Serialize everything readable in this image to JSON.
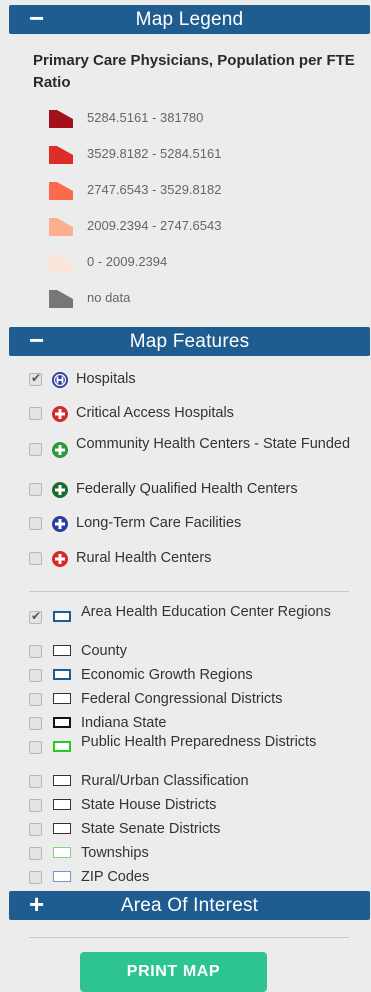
{
  "legend": {
    "header_title": "Map Legend",
    "header_sign": "−",
    "heading": "Primary Care Physicians, Population per FTE Ratio",
    "items": [
      {
        "label": "5284.5161 - 381780",
        "color": "#a3101c"
      },
      {
        "label": "3529.8182 - 5284.5161",
        "color": "#de2d26"
      },
      {
        "label": "2747.6543 - 3529.8182",
        "color": "#fb6a4a"
      },
      {
        "label": "2009.2394 - 2747.6543",
        "color": "#fcae91"
      },
      {
        "label": "0 - 2009.2394",
        "color": "#fee5d9"
      },
      {
        "label": "no data",
        "color": "#777777"
      }
    ]
  },
  "features": {
    "header_title": "Map Features",
    "header_sign": "−",
    "points": [
      {
        "label": "Hospitals",
        "checked": true,
        "icon": "hospital-h-icon",
        "color": "#2b3d9e"
      },
      {
        "label": "Critical Access Hospitals",
        "checked": false,
        "icon": "red-plus-icon",
        "color": "#d32a2a"
      },
      {
        "label": "Community Health Centers - State Funded",
        "checked": false,
        "icon": "green-plus-icon",
        "color": "#2a9a3a"
      },
      {
        "label": "Federally Qualified Health Centers",
        "checked": false,
        "icon": "dark-green-plus-icon",
        "color": "#1e6b2e"
      },
      {
        "label": "Long-Term Care Facilities",
        "checked": false,
        "icon": "blue-plus-icon",
        "color": "#2b3d9e"
      },
      {
        "label": "Rural Health Centers",
        "checked": false,
        "icon": "red-outline-plus-icon",
        "color": "#d32a2a"
      }
    ],
    "boundaries": [
      {
        "label": "Area Health Education Center Regions",
        "checked": true,
        "border": "#1f5c8f"
      },
      {
        "label": "County",
        "checked": false,
        "border": "#333333"
      },
      {
        "label": "Economic Growth Regions",
        "checked": false,
        "border": "#1f5c8f"
      },
      {
        "label": "Federal Congressional Districts",
        "checked": false,
        "border": "#333333"
      },
      {
        "label": "Indiana State",
        "checked": false,
        "border": "#111111"
      },
      {
        "label": "Public Health Preparedness Districts",
        "checked": false,
        "border": "#22cc22"
      },
      {
        "label": "Rural/Urban Classification",
        "checked": false,
        "border": "#333333"
      },
      {
        "label": "State House Districts",
        "checked": false,
        "border": "#333333"
      },
      {
        "label": "State Senate Districts",
        "checked": false,
        "border": "#333333"
      },
      {
        "label": "Townships",
        "checked": false,
        "border": "#7dd87d"
      },
      {
        "label": "ZIP Codes",
        "checked": false,
        "border": "#6a9ad0"
      }
    ]
  },
  "area_of_interest": {
    "header_title": "Area Of Interest",
    "header_sign": "+"
  },
  "print_button": "PRINT MAP"
}
